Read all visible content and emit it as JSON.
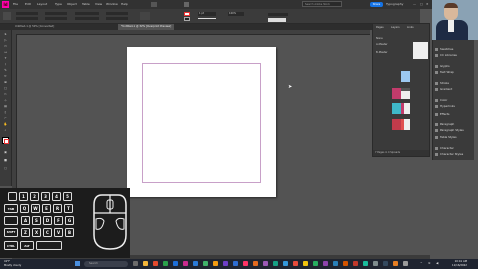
{
  "app": {
    "logo": "Id",
    "name": "InDesign"
  },
  "menu": [
    "File",
    "Edit",
    "Layout",
    "Type",
    "Object",
    "Table",
    "View",
    "Window",
    "Help",
    "Bridge",
    "Stock"
  ],
  "share_label": "Share",
  "workspace_label": "Typography",
  "search_placeholder": "Search Adobe Stock",
  "doc_tabs": [
    {
      "label": "Untitled-1 @ 50% [Converted]",
      "active": false
    },
    {
      "label": "*Untitled-1 @ 32% [Overprint Preview]",
      "active": true
    }
  ],
  "control": {
    "stroke_weight": "1 pt",
    "zoom": "100%",
    "opacity": "100%"
  },
  "pages_panel": {
    "tabs": [
      "Pages",
      "Layers",
      "Links"
    ],
    "rows": [
      "None",
      "A-Master",
      "B-Master"
    ],
    "footer": "7 Pages in 4 Spreads"
  },
  "dock": {
    "items": [
      "Swatches",
      "CC Libraries",
      "Glyphs",
      "Text Wrap",
      "Stroke",
      "Gradient",
      "Color",
      "Hyperlinks",
      "Effects",
      "Paragraph",
      "Paragraph Styles",
      "Table Styles",
      "Character",
      "Character Styles"
    ]
  },
  "keyboard": {
    "rows": [
      [
        "",
        "1",
        "2",
        "3",
        "4",
        "5"
      ],
      [
        "TAB",
        "Q",
        "W",
        "E",
        "R",
        "T"
      ],
      [
        "",
        "A",
        "S",
        "D",
        "F",
        "G"
      ],
      [
        "SHIFT",
        "Z",
        "X",
        "C",
        "V",
        "B"
      ],
      [
        "CTRL",
        "ALT",
        ""
      ]
    ]
  },
  "taskbar": {
    "weather_temp": "41°F",
    "weather_desc": "Mostly cloudy",
    "search": "Search",
    "time": "10:41 AM",
    "date": "11/16/2022"
  },
  "colors": {
    "accent": "#ff3399",
    "indesign": "#ff3366",
    "share": "#1473e6"
  }
}
